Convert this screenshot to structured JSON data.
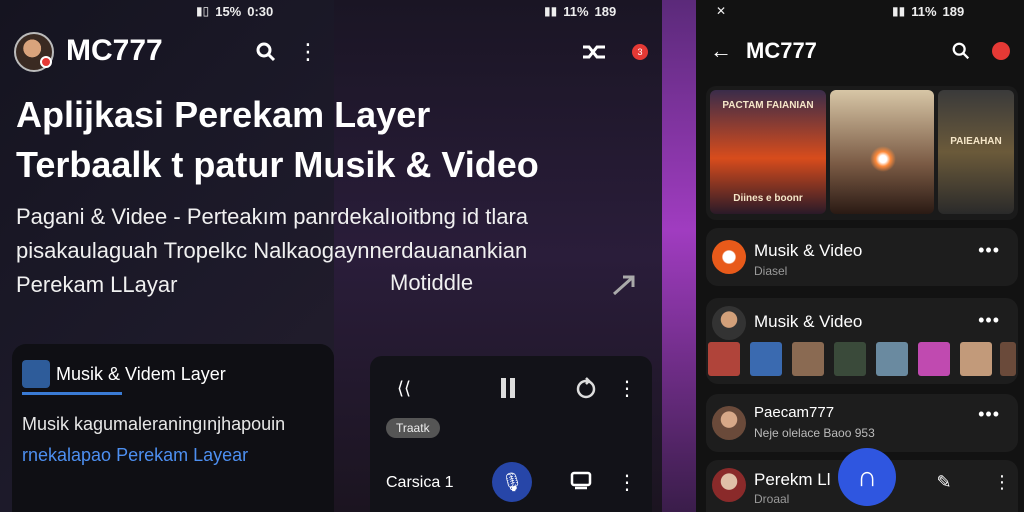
{
  "left": {
    "status_time": "0:30",
    "status_battery": "15%",
    "app_title": "MC777",
    "headline_line1": "Aplijkasi Perekam Layer",
    "headline_line2": "Terbaalk t patur Musik & Video",
    "sub_line1": "Pagani & Videe - Perteakım panrdekalıoitbng id tlara",
    "sub_line2": "pisakaulaguah  Tropelkc Nalkaogaynnerdauanankian",
    "sub_line3": "Perekam LLayar",
    "card_title": "Musik & Videm Layer",
    "card_line1": "Musik kagumaleraningınjhapouin",
    "card_line2": "rnekalapao Perekam Layear"
  },
  "middle": {
    "status_time": "189",
    "status_battery": "11%",
    "sub_right": "Motiddle",
    "pill": "Traatk",
    "player_label": "Carsica 1"
  },
  "right": {
    "status_time": "189",
    "status_battery": "11%",
    "app_title": "MC777",
    "gallery": [
      {
        "caption_top": "PACTAM FAIANIAN",
        "caption_bottom": "Diines e boonr"
      },
      {
        "caption_top": "",
        "caption_bottom": ""
      },
      {
        "caption_top": "PAIEAHAN",
        "caption_bottom": ""
      }
    ],
    "rows": [
      {
        "title": "Musik & Video",
        "sub": "Diasel"
      },
      {
        "title": "Musik & Video",
        "sub": ""
      },
      {
        "title": "Paecam777",
        "sub": "Neje olelace  Baoo 953"
      },
      {
        "title": "Perekm Ll",
        "sub": "Droaal"
      }
    ]
  },
  "colors": {
    "accent_blue": "#2f56e0",
    "badge_red": "#e53935",
    "link_blue": "#4d8ff0"
  }
}
